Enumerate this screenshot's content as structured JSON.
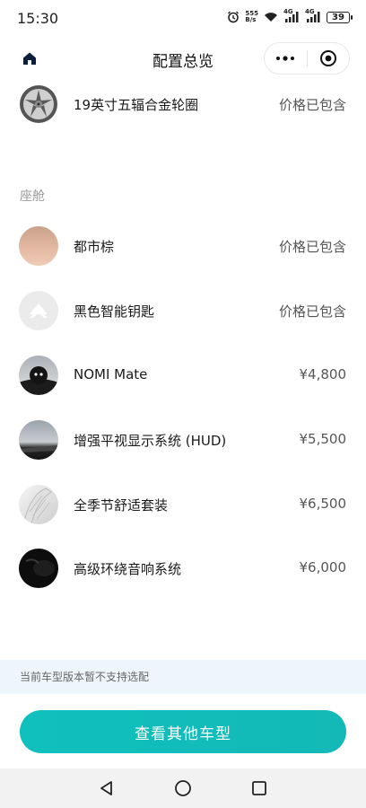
{
  "status_bar": {
    "time": "15:30",
    "net_speed_value": "555",
    "net_speed_unit": "B/s",
    "signal1": "4G",
    "signal2": "4G",
    "battery": "39"
  },
  "header": {
    "title": "配置总览",
    "icons": [
      "home-icon",
      "more-icon",
      "target-icon"
    ]
  },
  "top_item": {
    "name": "19英寸五辐合金轮圈",
    "price": "价格已包含",
    "icon": "wheel-icon"
  },
  "cabin": {
    "section_title": "座舱",
    "items": [
      {
        "name": "都市棕",
        "price": "价格已包含",
        "icon": "color-swatch"
      },
      {
        "name": "黑色智能钥匙",
        "price": "价格已包含",
        "icon": "key-icon"
      },
      {
        "name": "NOMI Mate",
        "price": "¥4,800",
        "icon": "nomi-icon"
      },
      {
        "name": "增强平视显示系统 (HUD)",
        "price": "¥5,500",
        "icon": "hud-icon"
      },
      {
        "name": "全季节舒适套装",
        "price": "¥6,500",
        "icon": "seat-icon"
      },
      {
        "name": "高级环绕音响系统",
        "price": "¥6,000",
        "icon": "speaker-icon"
      }
    ]
  },
  "notice": "当前车型版本暂不支持选配",
  "cta_label": "查看其他车型",
  "colors": {
    "accent": "#13b9b6",
    "notice_bg": "#eef6fc"
  },
  "nav": [
    "back-icon",
    "home-circle-icon",
    "recents-icon"
  ]
}
